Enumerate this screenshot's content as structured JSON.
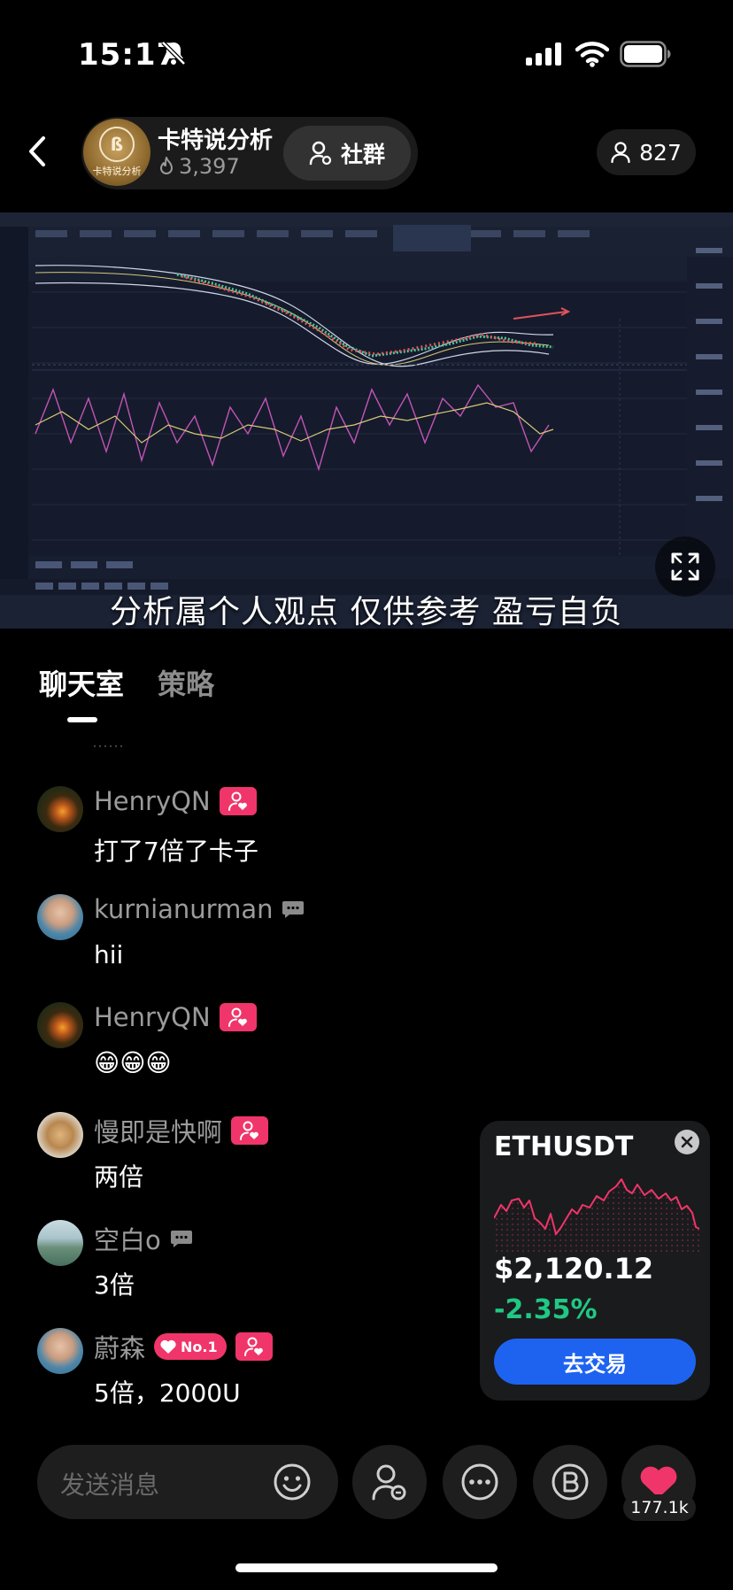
{
  "status_bar": {
    "time": "15:17"
  },
  "header": {
    "host_name": "卡特说分析",
    "host_logo_text": "卡特说分析",
    "host_likes": "3,397",
    "community_label": "社群",
    "viewer_count": "827"
  },
  "video": {
    "subtitle": "分析属个人观点 仅供参考 盈亏自负"
  },
  "tabs": {
    "chat": "聊天室",
    "strategy": "策略"
  },
  "chat": {
    "faded_text": "……",
    "messages": [
      {
        "user": "HenryQN",
        "text": "打了7倍了卡子"
      },
      {
        "user": "kurnianurman",
        "text": "hii"
      },
      {
        "user": "HenryQN",
        "text": "😁😁😁"
      },
      {
        "user": "慢即是快啊",
        "text": "两倍"
      },
      {
        "user": "空白o",
        "text": "3倍"
      },
      {
        "user": "蔚森",
        "badge": "No.1",
        "text": "5倍，2000U"
      }
    ]
  },
  "ticker": {
    "symbol": "ETHUSDT",
    "price": "$2,120.12",
    "change": "-2.35%",
    "trade_label": "去交易",
    "change_color": "#20c884",
    "spark_color": "#f0356a"
  },
  "bottom_bar": {
    "input_placeholder": "发送消息",
    "like_count": "177.1k"
  }
}
